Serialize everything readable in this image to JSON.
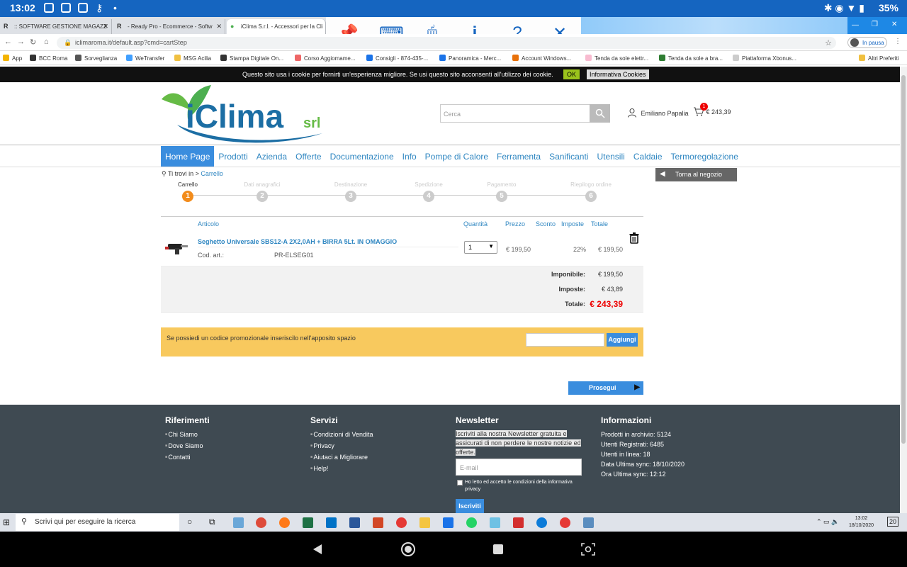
{
  "status": {
    "time": "13:02",
    "battery": "35%"
  },
  "tabs": [
    {
      "label": ":: SOFTWARE GESTIONE MAGAZZ",
      "fav": "R"
    },
    {
      "label": "- Ready Pro - Ecommerce - Softw",
      "fav": "R"
    },
    {
      "label": "iClima S.r.l. - Accessori per la Cli",
      "fav": "●"
    }
  ],
  "address": {
    "url": "iclimaroma.it/default.asp?cmd=cartStep",
    "pause_label": "In pausa"
  },
  "bookmarks": [
    "App",
    "BCC Roma",
    "Sorveglianza",
    "WeTransfer",
    "MSG Acilia",
    "Stampa Digitale On...",
    "Corso Aggiomame...",
    "Consigli - 874-435-...",
    "Panoramica - Merc...",
    "Account Windows...",
    "Tenda da sole elettr...",
    "Tenda da sole a bra...",
    "Piattaforma Xbonus...",
    "Altri Preferiti"
  ],
  "cookie": {
    "text": "Questo sito usa i cookie per fornirti un'esperienza migliore. Se usi questo sito acconsenti all'utilizzo dei cookie.",
    "ok": "OK",
    "info": "Informativa Cookies"
  },
  "header": {
    "search_placeholder": "Cerca",
    "user": "Emiliano Papalia",
    "cart_count": "1",
    "cart_total": "€ 243,39"
  },
  "menu": [
    "Home Page",
    "Prodotti",
    "Azienda",
    "Offerte",
    "Documentazione",
    "Info",
    "Pompe di Calore",
    "Ferramenta",
    "Sanificanti",
    "Utensili",
    "Caldaie",
    "Termoregolazione"
  ],
  "breadcrumb": {
    "prefix": "Ti trovi in",
    "sep": ">",
    "current": "Carrello"
  },
  "back_button": "Torna al negozio",
  "steps": [
    {
      "label": "Carrello",
      "n": "1"
    },
    {
      "label": "Dati anagrafici",
      "n": "2"
    },
    {
      "label": "Destinazione",
      "n": "3"
    },
    {
      "label": "Spedizione",
      "n": "4"
    },
    {
      "label": "Pagamento",
      "n": "5"
    },
    {
      "label": "Riepilogo ordine",
      "n": "6"
    }
  ],
  "cart": {
    "headers": {
      "article": "Articolo",
      "qty": "Quantità",
      "price": "Prezzo",
      "discount": "Sconto",
      "tax": "Imposte",
      "total": "Totale"
    },
    "item": {
      "name": "Seghetto Universale SBS12-A 2X2,0AH + BIRRA 5Lt. IN OMAGGIO",
      "code_label": "Cod. art.:",
      "code": "PR-ELSEG01",
      "qty": "1",
      "price": "€ 199,50",
      "tax": "22%",
      "total": "€ 199,50"
    },
    "summary": [
      {
        "label": "Imponibile:",
        "value": "€ 199,50"
      },
      {
        "label": "Imposte:",
        "value": "€ 43,89"
      },
      {
        "label": "Totale:",
        "value": "€ 243,39"
      }
    ]
  },
  "promo": {
    "text": "Se possiedi un codice promozionale inseriscilo nell'apposito spazio",
    "button": "Aggiungi"
  },
  "proceed": "Prosegui",
  "footer": {
    "riferimenti": {
      "title": "Riferimenti",
      "links": [
        "Chi Siamo",
        "Dove Siamo",
        "Contatti"
      ]
    },
    "servizi": {
      "title": "Servizi",
      "links": [
        "Condizioni di Vendita",
        "Privacy",
        "Aiutaci a Migliorare",
        "Help!"
      ]
    },
    "newsletter": {
      "title": "Newsletter",
      "text": "Iscriviti alla nostra Newsletter gratuita e assicurati di non perdere le nostre notizie ed offerte.",
      "email_placeholder": "E-mail",
      "consent": "Ho letto ed accetto le condizioni della informativa privacy",
      "button": "Iscriviti"
    },
    "informazioni": {
      "title": "Informazioni",
      "lines": [
        "Prodotti in archivio: 5124",
        "Utenti Registrati: 6485",
        "Utenti in linea: 18",
        "Data Ultima sync: 18/10/2020",
        "Ora Ultima sync: 12:12"
      ]
    }
  },
  "taskbar": {
    "search": "Scrivi qui per eseguire la ricerca",
    "time": "13:02",
    "date": "18/10/2020",
    "notif": "20"
  },
  "colors": {
    "brand_green": "#4caf50",
    "brand_blue": "#1c6ea4",
    "link": "#2e86c1",
    "accent_orange": "#f28c1c",
    "promo_bg": "#f8c95e",
    "footer_bg": "#3f4a52"
  }
}
